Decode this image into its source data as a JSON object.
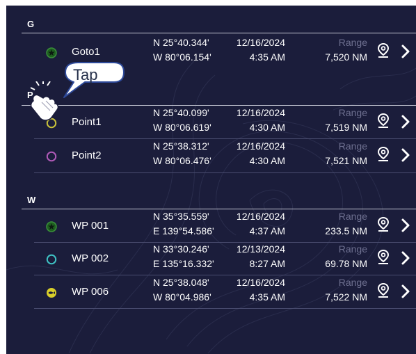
{
  "sections": [
    {
      "letter": "G"
    },
    {
      "letter": "P"
    },
    {
      "letter": "W"
    }
  ],
  "range_label": "Range",
  "waypoints": [
    {
      "name": "Goto1",
      "icon": "star-circle-icon",
      "icon_color": "#3a8f3a",
      "lat": "N 25°40.344'",
      "lon": "W 80°06.154'",
      "date": "12/16/2024",
      "time": "4:35 AM",
      "range": "7,520 NM"
    },
    {
      "name": "Point1",
      "icon": "circle-icon",
      "icon_color": "#c9c23a",
      "lat": "N 25°40.099'",
      "lon": "W 80°06.619'",
      "date": "12/16/2024",
      "time": "4:30 AM",
      "range": "7,519 NM"
    },
    {
      "name": "Point2",
      "icon": "circle-icon",
      "icon_color": "#b05ab8",
      "lat": "N 25°38.312'",
      "lon": "W 80°06.476'",
      "date": "12/16/2024",
      "time": "4:30 AM",
      "range": "7,521 NM"
    },
    {
      "name": "WP 001",
      "icon": "star-circle-icon",
      "icon_color": "#3a8f3a",
      "lat": "N 35°35.559'",
      "lon": "E 139°54.586'",
      "date": "12/16/2024",
      "time": "4:37 AM",
      "range": "233.5 NM"
    },
    {
      "name": "WP 002",
      "icon": "circle-icon",
      "icon_color": "#3fc2c4",
      "lat": "N 33°30.246'",
      "lon": "E 135°16.332'",
      "date": "12/13/2024",
      "time": "8:27 AM",
      "range": "69.78 NM"
    },
    {
      "name": "WP 006",
      "icon": "fish-circle-icon",
      "icon_color": "#d9cf2a",
      "lat": "N 25°38.048'",
      "lon": "W 80°04.986'",
      "date": "12/16/2024",
      "time": "4:35 AM",
      "range": "7,522 NM"
    }
  ],
  "callout": {
    "text": "Tap",
    "icon": "tapping-hand-icon"
  }
}
